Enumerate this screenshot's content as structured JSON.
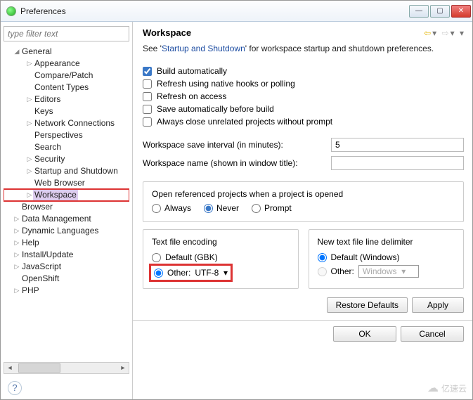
{
  "window": {
    "title": "Preferences"
  },
  "filter": {
    "placeholder": "type filter text"
  },
  "tree": {
    "general": "General",
    "appearance": "Appearance",
    "comparepatch": "Compare/Patch",
    "contenttypes": "Content Types",
    "editors": "Editors",
    "keys": "Keys",
    "network": "Network Connections",
    "perspectives": "Perspectives",
    "search": "Search",
    "security": "Security",
    "startup": "Startup and Shutdown",
    "webbrowser": "Web Browser",
    "workspace": "Workspace",
    "browser": "Browser",
    "datamgmt": "Data Management",
    "dynlang": "Dynamic Languages",
    "help": "Help",
    "install": "Install/Update",
    "javascript": "JavaScript",
    "openshift": "OpenShift",
    "php": "PHP"
  },
  "page": {
    "heading": "Workspace",
    "desc_pre": "See '",
    "desc_link": "Startup and Shutdown",
    "desc_post": "' for workspace startup and shutdown preferences.",
    "chk_build": "Build automatically",
    "chk_refresh_native": "Refresh using native hooks or polling",
    "chk_refresh_access": "Refresh on access",
    "chk_save_before": "Save automatically before build",
    "chk_close_unrelated": "Always close unrelated projects without prompt",
    "save_interval_lbl": "Workspace save interval (in minutes):",
    "save_interval_val": "5",
    "ws_name_lbl": "Workspace name (shown in window title):",
    "ws_name_val": "",
    "openref": {
      "title": "Open referenced projects when a project is opened",
      "always": "Always",
      "never": "Never",
      "prompt": "Prompt"
    },
    "encoding": {
      "title": "Text file encoding",
      "default": "Default (GBK)",
      "other": "Other:",
      "other_val": "UTF-8"
    },
    "delimiter": {
      "title": "New text file line delimiter",
      "default": "Default (Windows)",
      "other": "Other:",
      "other_val": "Windows"
    },
    "restore": "Restore Defaults",
    "apply": "Apply",
    "ok": "OK",
    "cancel": "Cancel"
  },
  "watermark": "亿速云"
}
